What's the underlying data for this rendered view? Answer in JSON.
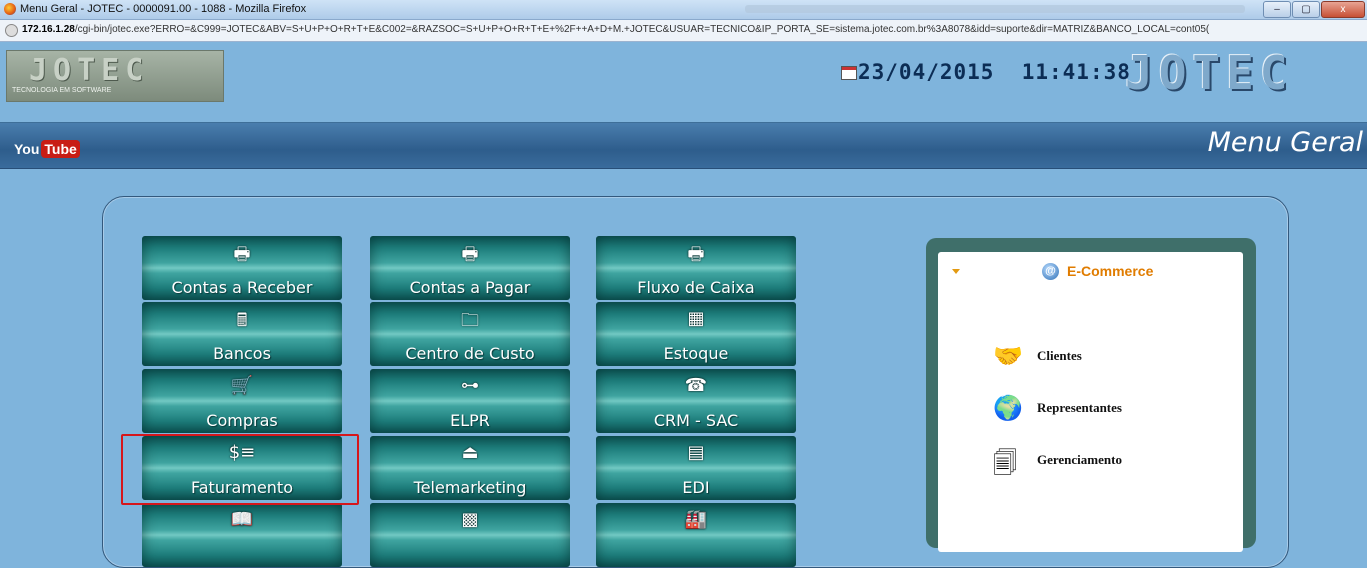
{
  "window": {
    "title": "Menu Geral - JOTEC - 0000091.00 - 1088 - Mozilla Firefox",
    "controls": [
      "–",
      "▢",
      "x"
    ]
  },
  "address": {
    "host": "172.16.1.28",
    "path": "/cgi-bin/jotec.exe?ERRO=&C999=JOTEC&ABV=S+U+P+O+R+T+E&C002=&RAZSOC=S+U+P+O+R+T+E+%2F++A+D+M.+JOTEC&USUAR=TECNICO&IP_PORTA_SE=sistema.jotec.com.br%3A8078&idd=suporte&dir=MATRIZ&BANCO_LOCAL=cont05("
  },
  "header": {
    "logo_text": "JOTEC",
    "logo_sub": "TECNOLOGIA EM SOFTWARE",
    "date": "23/04/2015",
    "time": "11:41:38",
    "brand": "JOTEC"
  },
  "nav": {
    "youtube_you": "You",
    "youtube_tube": "Tube",
    "page_title": "Menu Geral"
  },
  "menu": {
    "items": [
      {
        "label": "Contas a Receber",
        "icon": "🖶"
      },
      {
        "label": "Contas a Pagar",
        "icon": "🖶"
      },
      {
        "label": "Fluxo de Caixa",
        "icon": "🖶"
      },
      {
        "label": "Bancos",
        "icon": "🖩"
      },
      {
        "label": "Centro de Custo",
        "icon": "🗀"
      },
      {
        "label": "Estoque",
        "icon": "▦"
      },
      {
        "label": "Compras",
        "icon": "🛒"
      },
      {
        "label": "ELPR",
        "icon": "⊶"
      },
      {
        "label": "CRM - SAC",
        "icon": "☎"
      },
      {
        "label": "Faturamento",
        "icon": "$≡"
      },
      {
        "label": "Telemarketing",
        "icon": "⏏"
      },
      {
        "label": "EDI",
        "icon": "▤"
      },
      {
        "label": "",
        "icon": "📖"
      },
      {
        "label": "",
        "icon": "▩"
      },
      {
        "label": "",
        "icon": "🏭"
      }
    ]
  },
  "ecommerce": {
    "title": "E-Commerce",
    "at_symbol": "@",
    "items": [
      {
        "label": "Clientes",
        "icon": "🤝"
      },
      {
        "label": "Representantes",
        "icon": "🌍"
      },
      {
        "label": "Gerenciamento",
        "icon": "🗐"
      }
    ]
  }
}
